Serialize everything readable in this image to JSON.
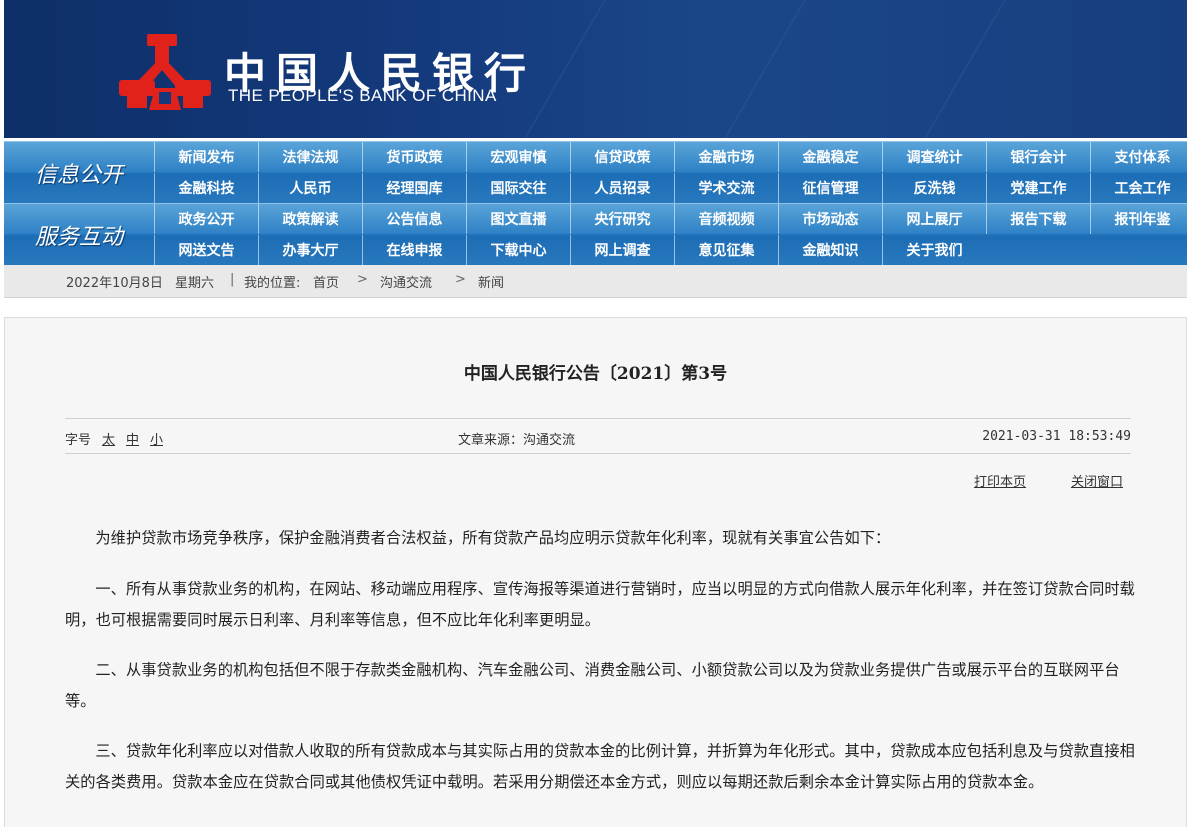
{
  "header": {
    "brand_cn": "中国人民银行",
    "brand_en": "THE PEOPLE'S BANK OF CHINA",
    "logo_color": "#e0221b"
  },
  "nav_info": {
    "title": "信息公开",
    "items": [
      "新闻发布",
      "法律法规",
      "货币政策",
      "宏观审慎",
      "信贷政策",
      "金融市场",
      "金融稳定",
      "调查统计",
      "银行会计",
      "支付体系",
      "金融科技",
      "人民币",
      "经理国库",
      "国际交往",
      "人员招录",
      "学术交流",
      "征信管理",
      "反洗钱",
      "党建工作",
      "工会工作"
    ]
  },
  "nav_service": {
    "title": "服务互动",
    "items": [
      "政务公开",
      "政策解读",
      "公告信息",
      "图文直播",
      "央行研究",
      "音频视频",
      "市场动态",
      "网上展厅",
      "报告下载",
      "报刊年鉴",
      "网送文告",
      "办事大厅",
      "在线申报",
      "下载中心",
      "网上调查",
      "意见征集",
      "金融知识",
      "关于我们"
    ]
  },
  "breadcrumb": {
    "date": "2022年10月8日",
    "weekday": "星期六",
    "sep": "|",
    "location_label": "我的位置:",
    "items": [
      "首页",
      "沟通交流",
      "新闻"
    ],
    "arrow": ">"
  },
  "article": {
    "title": "中国人民银行公告〔2021〕第3号",
    "font_size_label": "字号",
    "font_sizes": [
      "太",
      "中",
      "小"
    ],
    "source": "文章来源：沟通交流",
    "time": "2021-03-31 18:53:49",
    "print_label": "打印本页",
    "close_label": "关闭窗口",
    "paragraphs": [
      "为维护贷款市场竞争秩序，保护金融消费者合法权益，所有贷款产品均应明示贷款年化利率，现就有关事宜公告如下：",
      "一、所有从事贷款业务的机构，在网站、移动端应用程序、宣传海报等渠道进行营销时，应当以明显的方式向借款人展示年化利率，并在签订贷款合同时载明，也可根据需要同时展示日利率、月利率等信息，但不应比年化利率更明显。",
      "二、从事贷款业务的机构包括但不限于存款类金融机构、汽车金融公司、消费金融公司、小额贷款公司以及为贷款业务提供广告或展示平台的互联网平台等。",
      "三、贷款年化利率应以对借款人收取的所有贷款成本与其实际占用的贷款本金的比例计算，并折算为年化形式。其中，贷款成本应包括利息及与贷款直接相关的各类费用。贷款本金应在贷款合同或其他债权凭证中载明。若采用分期偿还本金方式，则应以每期还款后剩余本金计算实际占用的贷款本金。"
    ]
  }
}
